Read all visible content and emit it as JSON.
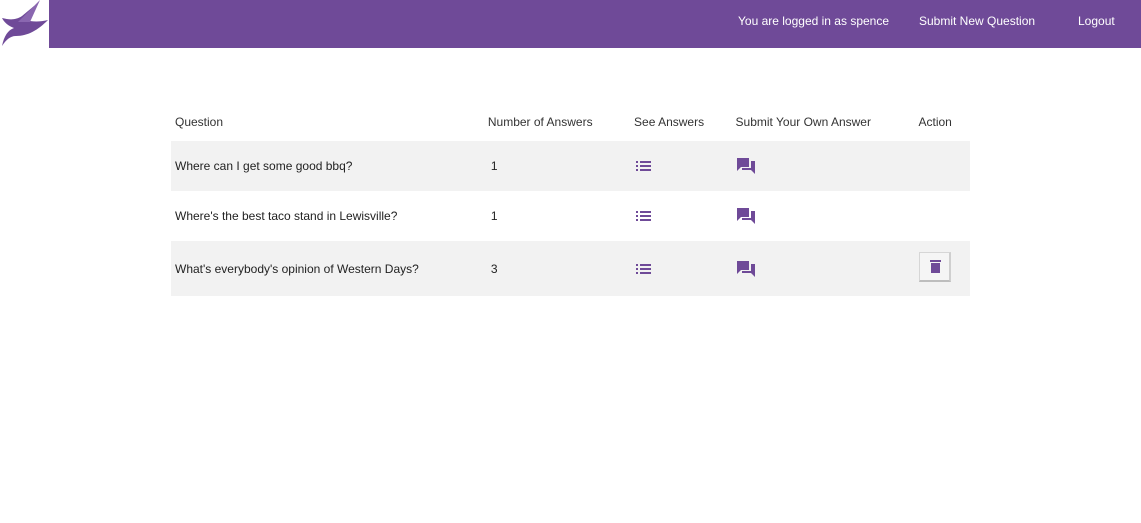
{
  "header": {
    "logged_in_text": "You are logged in as spence",
    "submit_label": "Submit New Question",
    "logout_label": "Logout",
    "colors": {
      "bar": "#6f4a98",
      "accent": "#6f4a98"
    }
  },
  "table": {
    "columns": [
      "Question",
      "Number of Answers",
      "See Answers",
      "Submit Your Own Answer",
      "Action"
    ],
    "rows": [
      {
        "question": "Where can I get some good bbq?",
        "answers": "1",
        "see_icon": "list-icon",
        "answer_icon": "forum-icon"
      },
      {
        "question": "Where's the best taco stand in Lewisville?",
        "answers": "1",
        "see_icon": "list-icon",
        "answer_icon": "forum-icon"
      },
      {
        "question": "What's everybody's opinion of Western Days?",
        "answers": "3",
        "see_icon": "list-icon",
        "answer_icon": "forum-icon",
        "action_icon": "delete-icon"
      }
    ]
  }
}
